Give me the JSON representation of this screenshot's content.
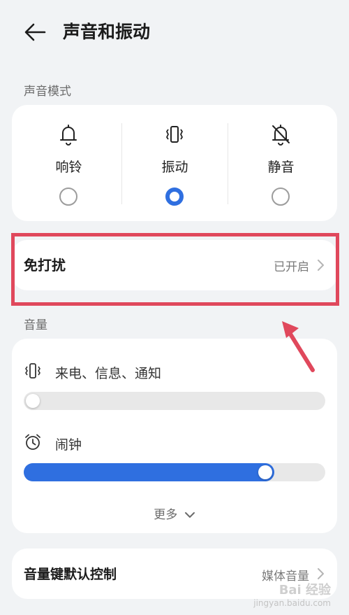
{
  "header": {
    "title": "声音和振动"
  },
  "sound_mode": {
    "section_label": "声音模式",
    "options": [
      {
        "label": "响铃",
        "icon": "bell-icon",
        "selected": false
      },
      {
        "label": "振动",
        "icon": "vibrate-icon",
        "selected": true
      },
      {
        "label": "静音",
        "icon": "bell-off-icon",
        "selected": false
      }
    ]
  },
  "do_not_disturb": {
    "label": "免打扰",
    "status": "已开启"
  },
  "volume": {
    "section_label": "音量",
    "rows": [
      {
        "label": "来电、信息、通知",
        "icon": "vibrate-icon",
        "level": 0.0
      },
      {
        "label": "闹钟",
        "icon": "alarm-clock-icon",
        "level": 0.82
      }
    ],
    "more_label": "更多"
  },
  "volume_key": {
    "label": "音量键默认控制",
    "value": "媒体音量"
  },
  "colors": {
    "accent": "#2f6fe0",
    "highlight": "#e0485c",
    "background": "#f1f3f5",
    "card": "#ffffff"
  },
  "watermark": {
    "brand": "Bai 经验",
    "url": "jingyan.baidu.com"
  }
}
